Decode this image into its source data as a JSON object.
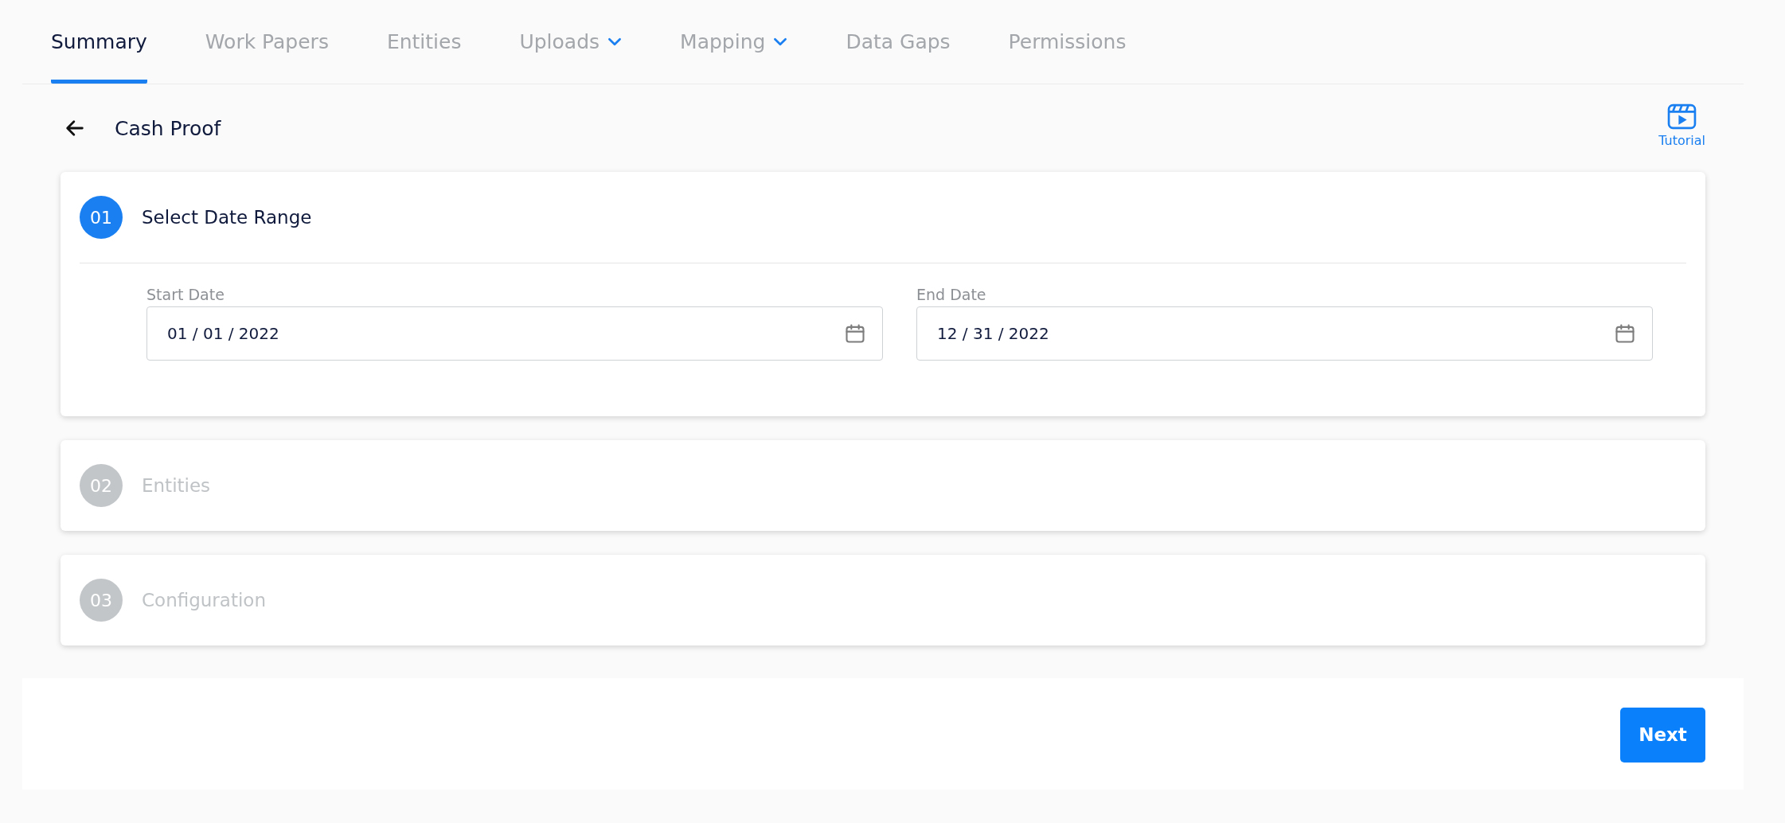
{
  "tabs": [
    {
      "label": "Summary",
      "selected": true,
      "dropdown": false
    },
    {
      "label": "Work Papers",
      "selected": false,
      "dropdown": false
    },
    {
      "label": "Entities",
      "selected": false,
      "dropdown": false
    },
    {
      "label": "Uploads",
      "selected": false,
      "dropdown": true
    },
    {
      "label": "Mapping",
      "selected": false,
      "dropdown": true
    },
    {
      "label": "Data Gaps",
      "selected": false,
      "dropdown": false
    },
    {
      "label": "Permissions",
      "selected": false,
      "dropdown": false
    }
  ],
  "page_title": "Cash Proof",
  "tutorial": {
    "label": "Tutorial"
  },
  "steps": [
    {
      "number": "01",
      "title": "Select Date Range",
      "active": true,
      "fields": [
        {
          "label": "Start Date",
          "value": "01 / 01 / 2022"
        },
        {
          "label": "End Date",
          "value": "12 / 31 / 2022"
        }
      ]
    },
    {
      "number": "02",
      "title": "Entities",
      "active": false
    },
    {
      "number": "03",
      "title": "Configuration",
      "active": false
    }
  ],
  "next_button": "Next"
}
